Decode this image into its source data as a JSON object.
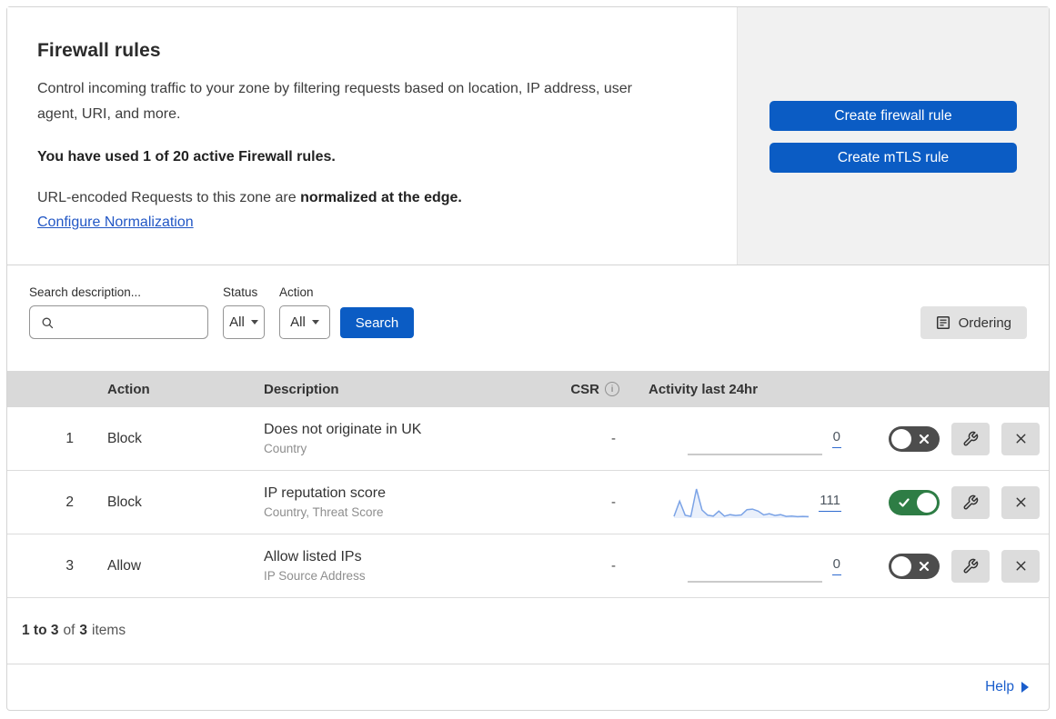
{
  "header": {
    "title": "Firewall rules",
    "description": "Control incoming traffic to your zone by filtering requests based on location, IP address, user agent, URI, and more.",
    "usage_text": "You have used 1 of 20 active Firewall rules.",
    "normalization_prefix": "URL-encoded Requests to this zone are",
    "normalization_bold": "normalized at the edge.",
    "normalization_link": "Configure Normalization",
    "create_firewall_button": "Create firewall rule",
    "create_mtls_button": "Create mTLS rule"
  },
  "filters": {
    "search_label": "Search description...",
    "status_label": "Status",
    "status_value": "All",
    "action_label": "Action",
    "action_value": "All",
    "search_button": "Search",
    "ordering_button": "Ordering"
  },
  "table": {
    "columns": {
      "action": "Action",
      "description": "Description",
      "csr": "CSR",
      "activity": "Activity last 24hr"
    },
    "rows": [
      {
        "priority": "1",
        "action": "Block",
        "description": "Does not originate in UK",
        "fields": "Country",
        "csr": "-",
        "activity_count": "0",
        "activity_series": [
          0,
          0
        ],
        "enabled": false
      },
      {
        "priority": "2",
        "action": "Block",
        "description": "IP reputation score",
        "fields": "Country, Threat Score",
        "csr": "-",
        "activity_count": "111",
        "activity_series": [
          6,
          58,
          10,
          6,
          100,
          28,
          10,
          7,
          24,
          7,
          12,
          9,
          11,
          29,
          31,
          24,
          11,
          15,
          9,
          12,
          6,
          7,
          5,
          6,
          5
        ],
        "enabled": true
      },
      {
        "priority": "3",
        "action": "Allow",
        "description": "Allow listed IPs",
        "fields": "IP Source Address",
        "csr": "-",
        "activity_count": "0",
        "activity_series": [
          0,
          0
        ],
        "enabled": false
      }
    ]
  },
  "footer": {
    "range": "1 to 3",
    "of_text": "of",
    "total": "3",
    "items_text": "items",
    "help_label": "Help"
  },
  "colors": {
    "accent_blue": "#0b5cc4",
    "link_blue": "#2257c5",
    "toggle_green": "#2e7d45",
    "toggle_off_gray": "#4d4d4d",
    "header_row_bg": "#d9d9d9",
    "spark_line": "#7ba3e6",
    "spark_fill": "rgba(123,163,230,0.16)",
    "spark_flat": "#b8b8b8"
  }
}
